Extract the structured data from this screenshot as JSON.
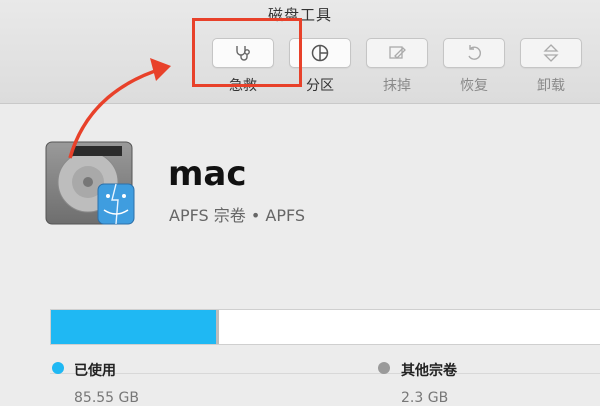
{
  "window": {
    "title": "磁盘工具"
  },
  "toolbar": {
    "items": [
      {
        "label": "急救",
        "icon": "stethoscope-icon",
        "enabled": true
      },
      {
        "label": "分区",
        "icon": "pie-chart-icon",
        "enabled": true
      },
      {
        "label": "抹掉",
        "icon": "erase-icon",
        "enabled": false
      },
      {
        "label": "恢复",
        "icon": "restore-icon",
        "enabled": false
      },
      {
        "label": "卸载",
        "icon": "eject-icon",
        "enabled": false
      }
    ]
  },
  "annotation": {
    "color": "#e8412a"
  },
  "volume": {
    "name": "mac",
    "subtitle": "APFS 宗卷 • APFS"
  },
  "storage": {
    "used_fraction": 0.3,
    "legend": [
      {
        "label": "已使用",
        "value": "85.55 GB",
        "color": "#1fb8f3"
      },
      {
        "label": "其他宗卷",
        "value": "2.3 GB",
        "color": "#9a9a9a"
      }
    ]
  }
}
